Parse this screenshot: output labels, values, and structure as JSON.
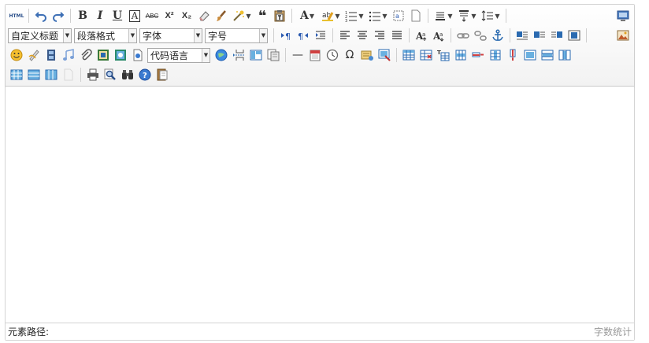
{
  "toolbar": {
    "combos": {
      "custom_heading": "自定义标题",
      "paragraph_format": "段落格式",
      "font_family": "字体",
      "font_size": "字号",
      "code_language": "代码语言"
    },
    "glyphs": {
      "html": "HTML",
      "bold": "B",
      "italic": "I",
      "underline": "U",
      "font_border": "A",
      "strike": "ABC",
      "superscript": "X²",
      "subscript": "X₂",
      "quote": "❝",
      "forecolor": "A",
      "omega": "Ω",
      "dash": "—"
    }
  },
  "statusbar": {
    "element_path_label": "元素路径:",
    "word_count_label": "字数统计"
  }
}
